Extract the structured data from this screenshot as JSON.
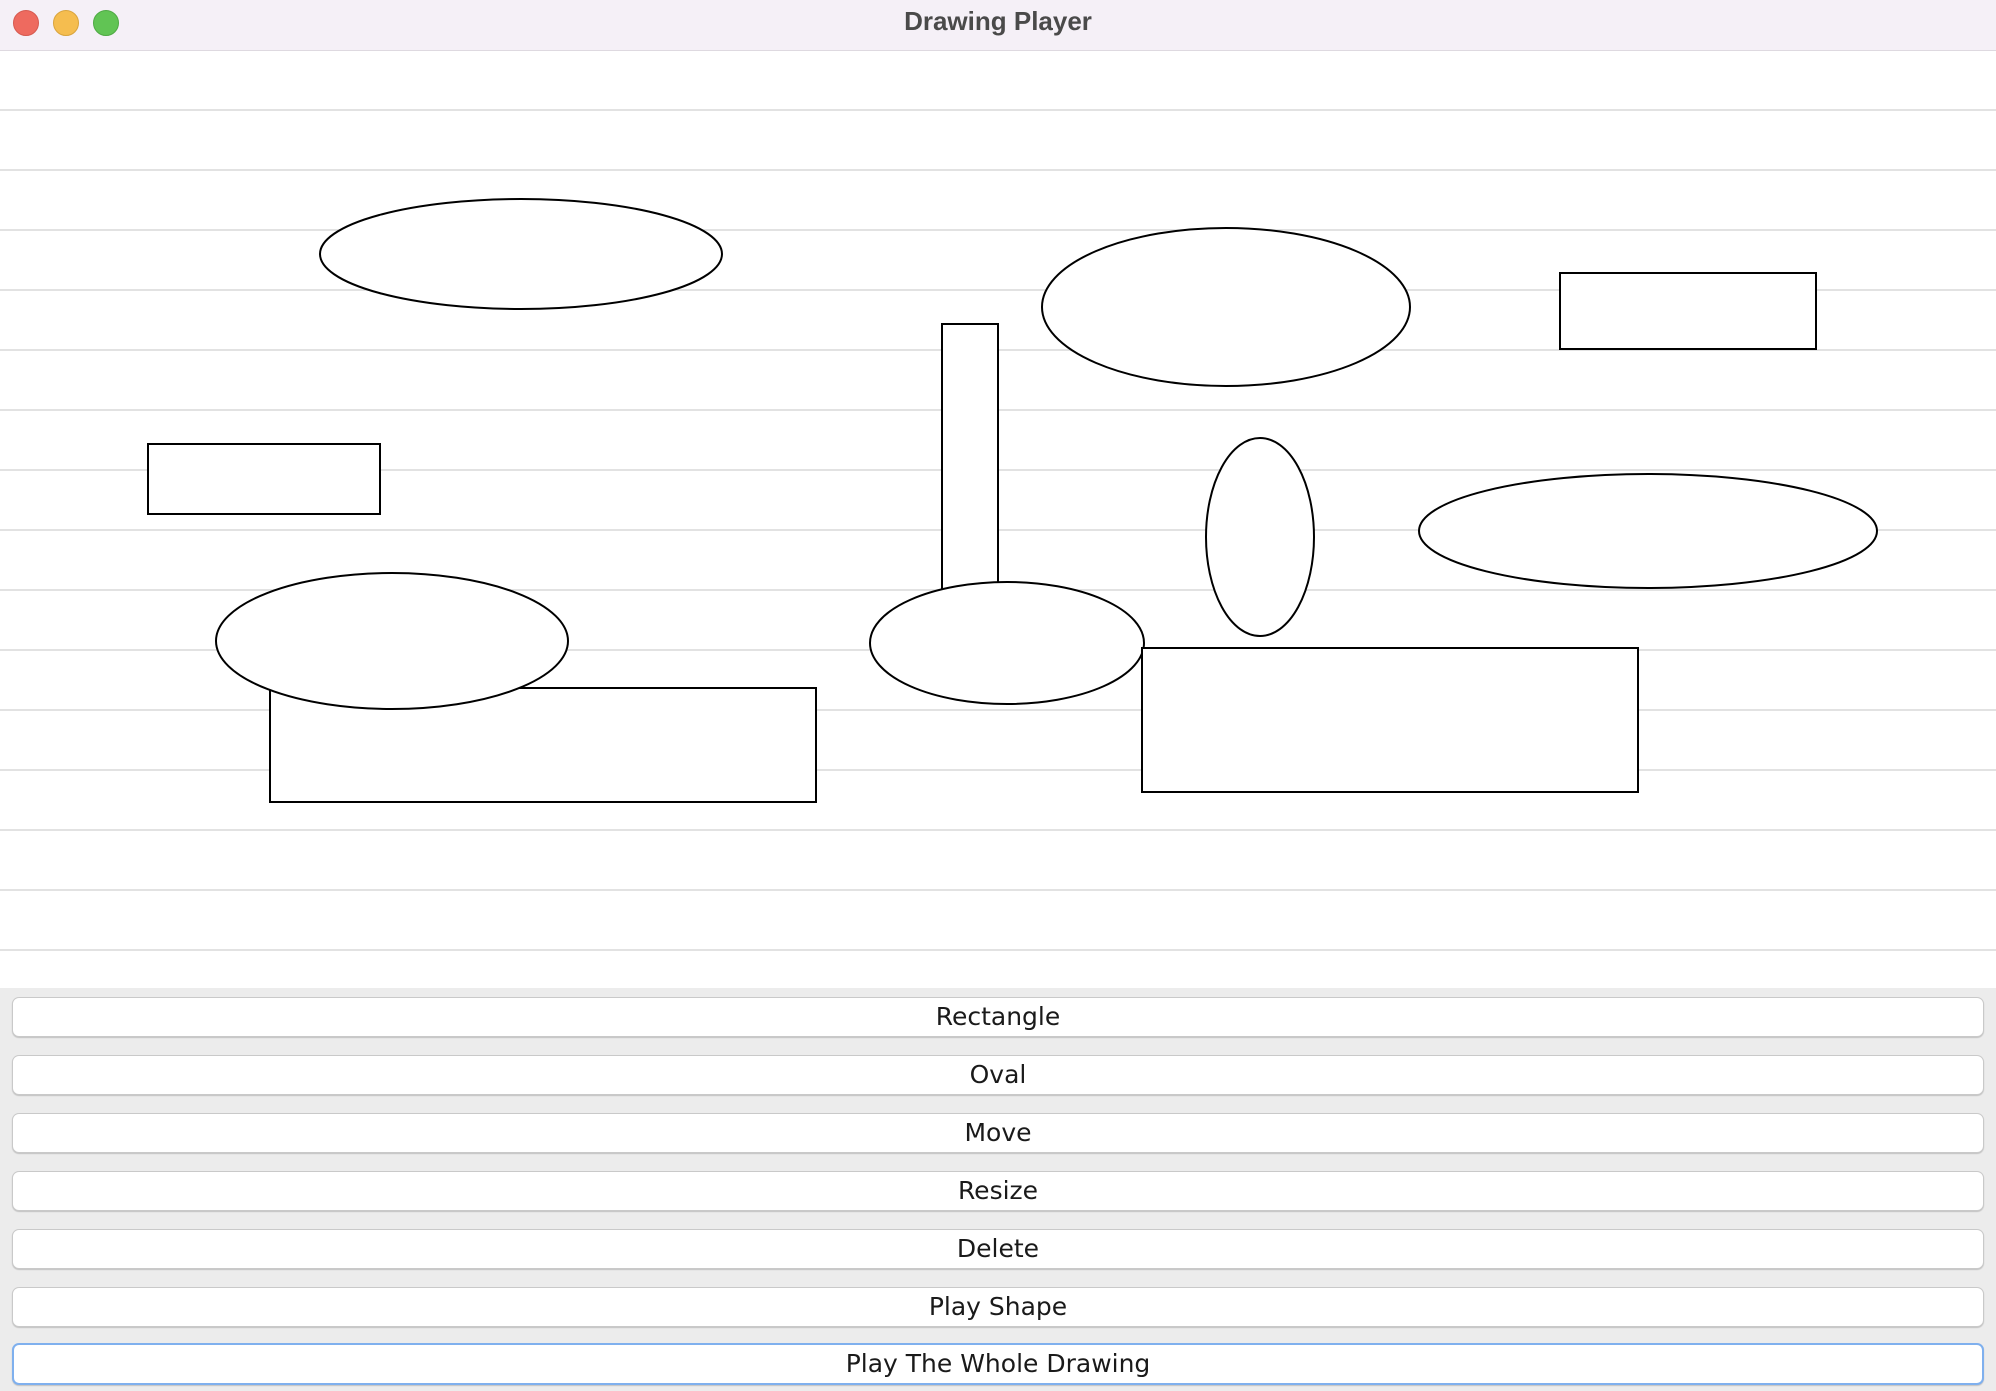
{
  "window": {
    "title": "Drawing Player"
  },
  "toolbar": {
    "buttons": [
      {
        "label": "Rectangle"
      },
      {
        "label": "Oval"
      },
      {
        "label": "Move"
      },
      {
        "label": "Resize"
      },
      {
        "label": "Delete"
      },
      {
        "label": "Play Shape"
      },
      {
        "label": "Play The Whole Drawing"
      }
    ],
    "focused_button": "Play The Whole Drawing"
  },
  "canvas": {
    "shape_types": [
      "rectangle",
      "oval"
    ],
    "stroke_color": "#000000",
    "fill_color": "#ffffff",
    "ruled_line_color": "#d9d9d9"
  },
  "colors": {
    "close": "#ee6a5f",
    "minimize": "#f5bd4f",
    "zoom": "#61c454",
    "focus_ring": "#7fb0ee"
  }
}
